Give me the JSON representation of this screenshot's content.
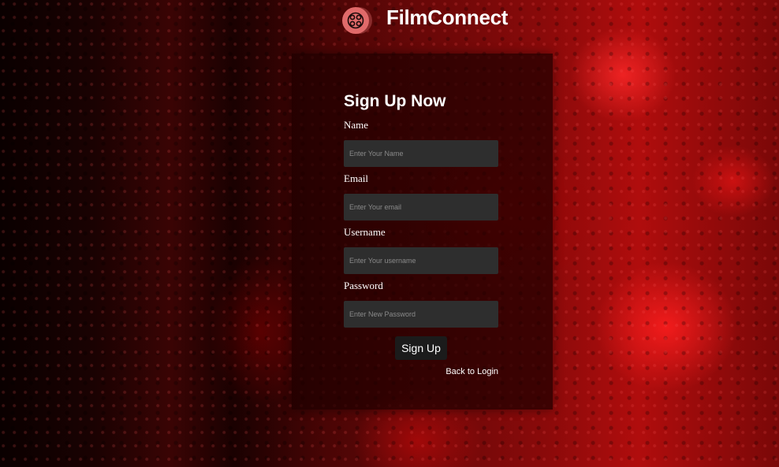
{
  "brand": {
    "name": "FilmConnect",
    "logo_icon": "film-reel-icon",
    "logo_color": "#e06a6a"
  },
  "form": {
    "title": "Sign Up Now",
    "fields": [
      {
        "label": "Name",
        "placeholder": "Enter Your Name",
        "value": ""
      },
      {
        "label": "Email",
        "placeholder": "Enter Your email",
        "value": ""
      },
      {
        "label": "Username",
        "placeholder": "Enter Your username",
        "value": ""
      },
      {
        "label": "Password",
        "placeholder": "Enter New Password",
        "value": ""
      }
    ],
    "submit_label": "Sign Up",
    "back_link_label": "Back to Login"
  }
}
